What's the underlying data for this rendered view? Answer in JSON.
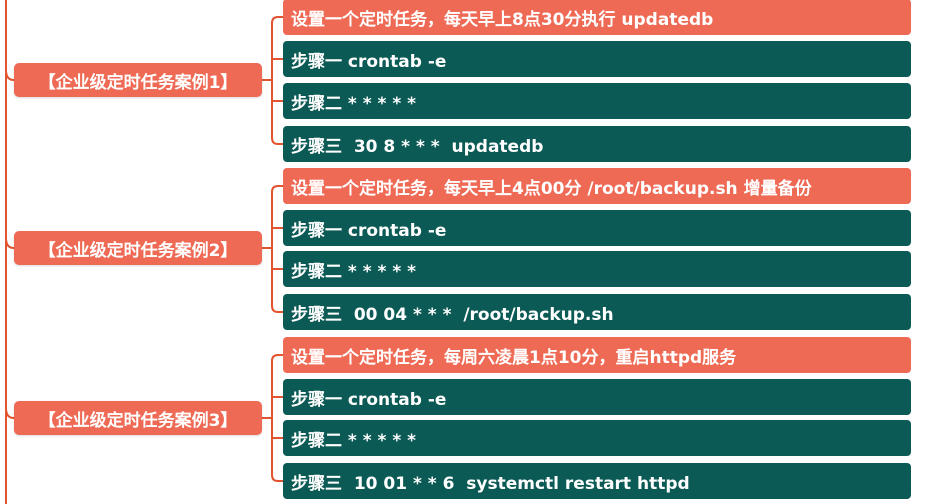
{
  "colors": {
    "case_bg": "#ee6a55",
    "title_bg": "#ee6a55",
    "step_bg": "#0c5a55",
    "connector": "#e2542f",
    "text": "#ffffff"
  },
  "cases": [
    {
      "label": "【企业级定时任务案例1】",
      "title": "设置一个定时任务，每天早上8点30分执行 updatedb",
      "step1": "步骤一 crontab -e",
      "step2": "步骤二 * * * * *",
      "step3": "步骤三  30 8 * * *  updatedb"
    },
    {
      "label": "【企业级定时任务案例2】",
      "title": "设置一个定时任务，每天早上4点00分 /root/backup.sh 增量备份",
      "step1": "步骤一 crontab -e",
      "step2": "步骤二 * * * * *",
      "step3": "步骤三  00 04 * * *  /root/backup.sh"
    },
    {
      "label": "【企业级定时任务案例3】",
      "title": "设置一个定时任务，每周六凌晨1点10分，重启httpd服务",
      "step1": "步骤一 crontab -e",
      "step2": "步骤二 * * * * *",
      "step3": "步骤三  10 01 * * 6  systemctl restart httpd"
    }
  ]
}
